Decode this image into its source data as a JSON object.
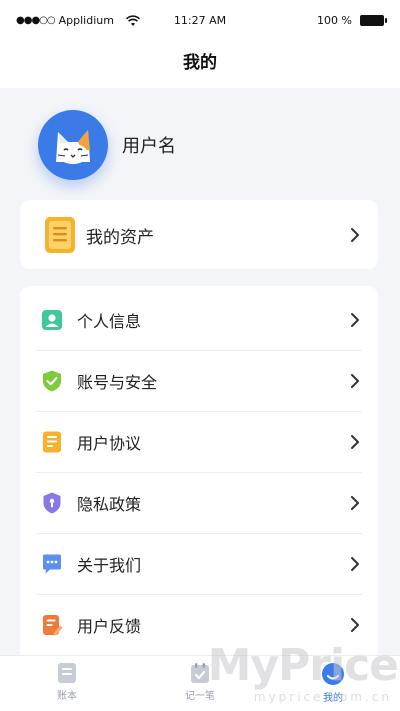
{
  "statusbar": {
    "carrier": "Applidium",
    "signal": "●●●○○",
    "time": "11:27 AM",
    "battery": "100 %"
  },
  "navbar": {
    "title": "我的"
  },
  "profile": {
    "username": "用户名"
  },
  "assets": {
    "label": "我的资产"
  },
  "menu": {
    "items": [
      {
        "label": "个人信息",
        "icon": "id-card-icon",
        "color": "#3fc89a"
      },
      {
        "label": "账号与安全",
        "icon": "shield-check-icon",
        "color": "#7ccc3a"
      },
      {
        "label": "用户协议",
        "icon": "document-icon",
        "color": "#f6b22b"
      },
      {
        "label": "隐私政策",
        "icon": "privacy-shield-icon",
        "color": "#8a78e8"
      },
      {
        "label": "关于我们",
        "icon": "chat-bubble-icon",
        "color": "#5b8ff0"
      },
      {
        "label": "用户反馈",
        "icon": "feedback-icon",
        "color": "#f07a3c"
      }
    ]
  },
  "tabbar": {
    "tabs": [
      {
        "label": "账本",
        "icon": "ledger-icon"
      },
      {
        "label": "记一笔",
        "icon": "calendar-icon"
      },
      {
        "label": "我的",
        "icon": "profile-icon",
        "active": true
      }
    ]
  },
  "watermark": {
    "text": "MyPrice",
    "sub": "myprice.com.cn"
  },
  "colors": {
    "accent": "#3b7be8",
    "background": "#f4f5f8"
  }
}
